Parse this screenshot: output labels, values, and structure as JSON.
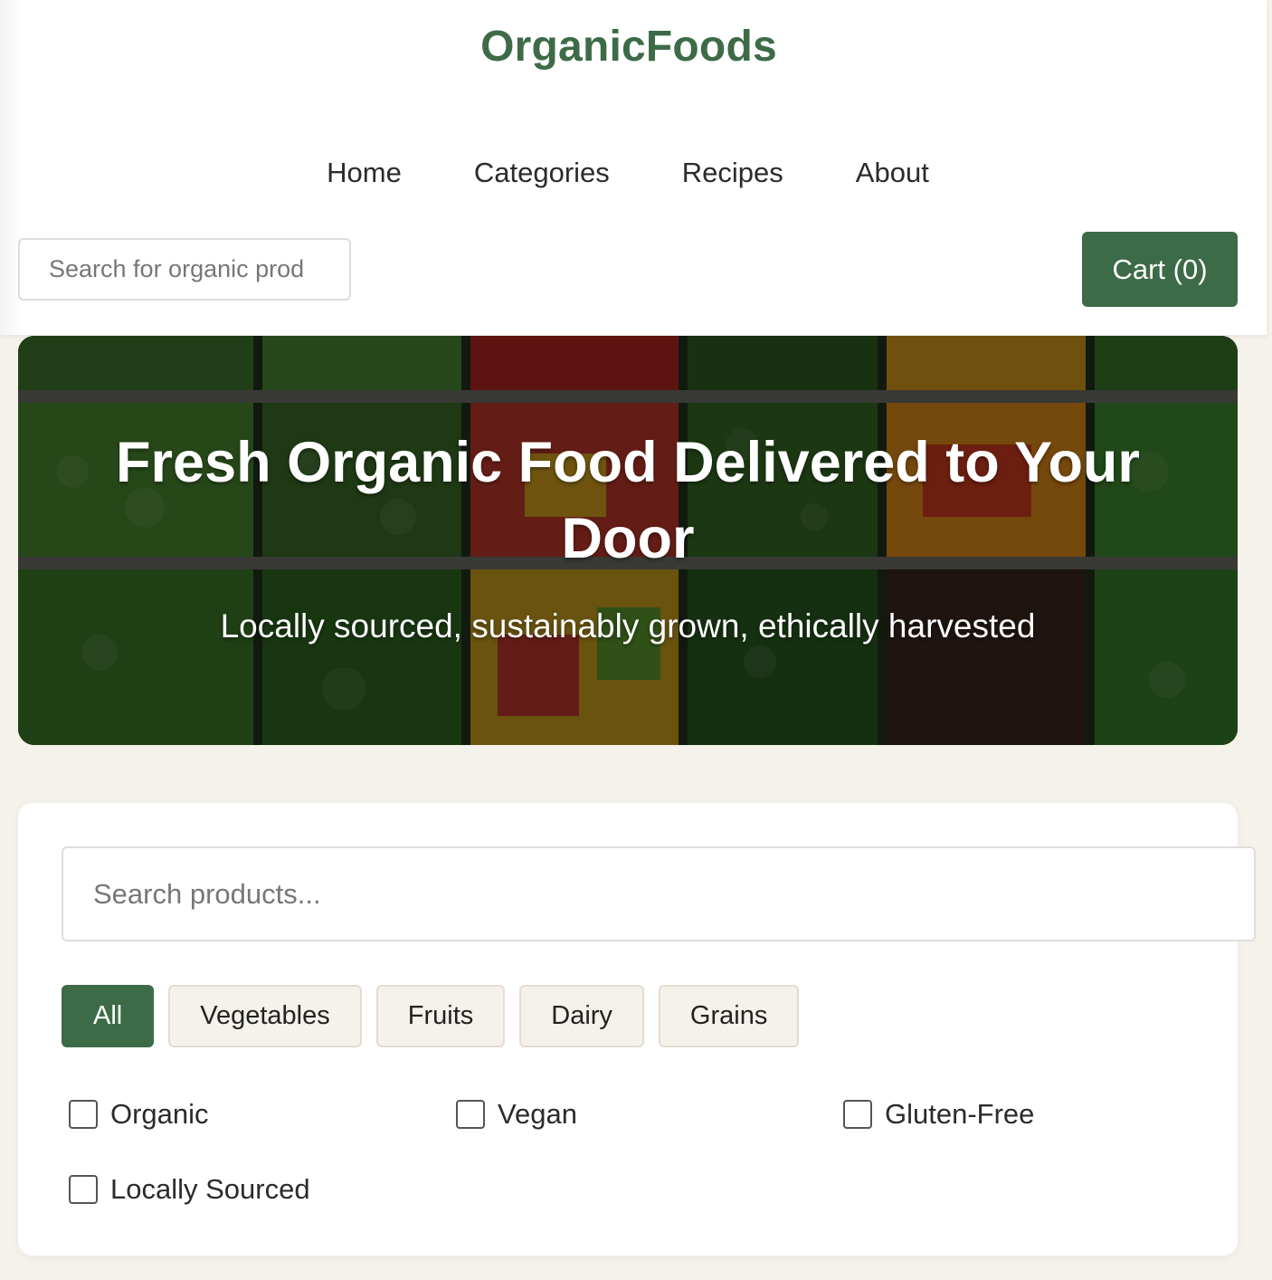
{
  "header": {
    "logo": "OrganicFoods",
    "nav": [
      "Home",
      "Categories",
      "Recipes",
      "About"
    ],
    "search_placeholder": "Search for organic prod",
    "cart_label": "Cart (0)"
  },
  "hero": {
    "title": "Fresh Organic Food Delivered to Your Door",
    "subtitle": "Locally sourced, sustainably grown, ethically harvested"
  },
  "filters": {
    "search_placeholder": "Search products...",
    "categories": [
      "All",
      "Vegetables",
      "Fruits",
      "Dairy",
      "Grains"
    ],
    "active_category": "All",
    "checkboxes": [
      {
        "label": "Organic",
        "checked": false
      },
      {
        "label": "Vegan",
        "checked": false
      },
      {
        "label": "Gluten-Free",
        "checked": false
      },
      {
        "label": "Locally Sourced",
        "checked": false
      }
    ]
  },
  "colors": {
    "brand": "#3d6b47",
    "page_background": "#f4f2ea"
  }
}
